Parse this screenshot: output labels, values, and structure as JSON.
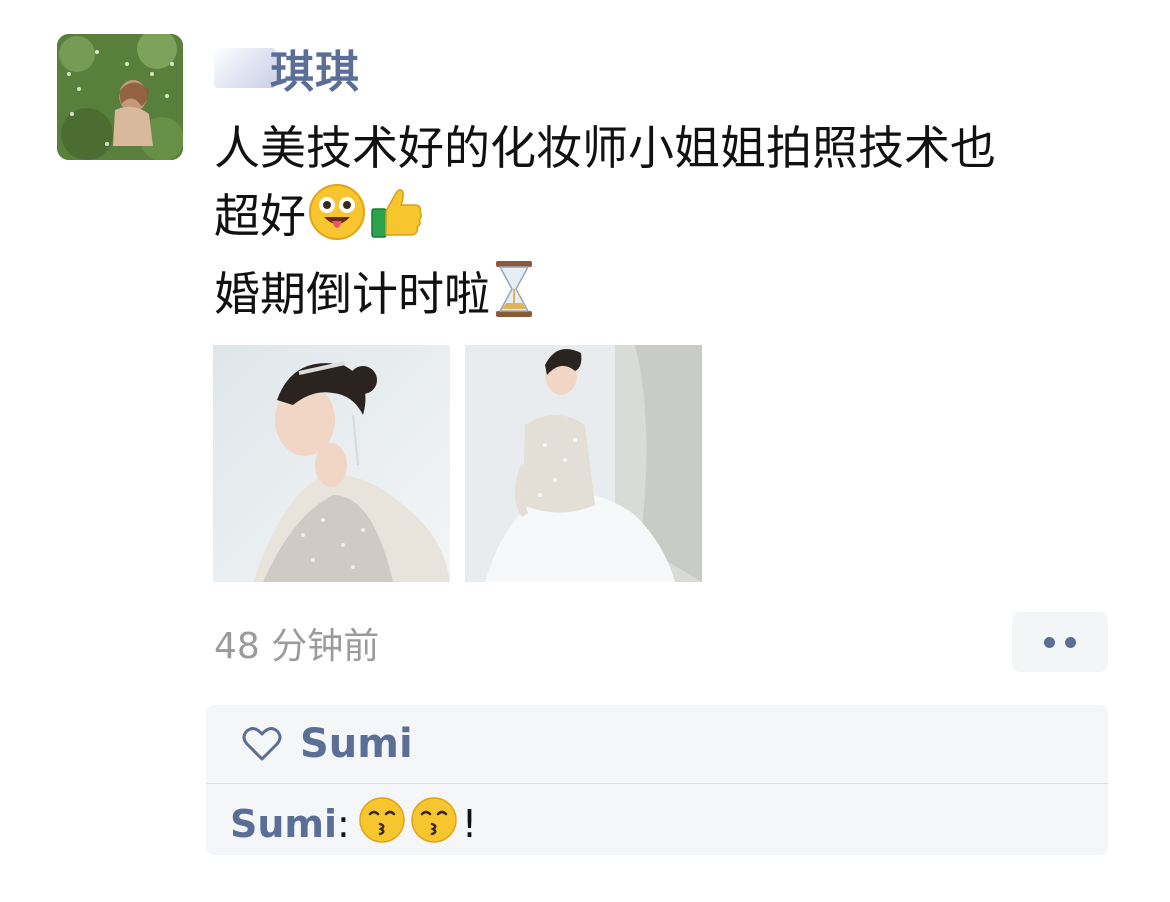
{
  "post": {
    "author_name": "琪琪",
    "text_lines": [
      "人美技术好的化妆师小姐姐拍照技术也",
      "超好",
      "婚期倒计时啦"
    ],
    "timestamp": "48 分钟前",
    "emojis": [
      "grinning-tongue-face",
      "thumbs-up",
      "hourglass"
    ]
  },
  "likes": {
    "names": [
      "Sumi"
    ]
  },
  "comments": [
    {
      "author": "Sumi",
      "separator": ":",
      "emojis": [
        "kissing-face",
        "kissing-face"
      ],
      "text": "!"
    }
  ],
  "colors": {
    "link_blue": "#5a6e96",
    "timestamp_gray": "#9b9b9b",
    "panel_bg": "#f5f6f7"
  }
}
